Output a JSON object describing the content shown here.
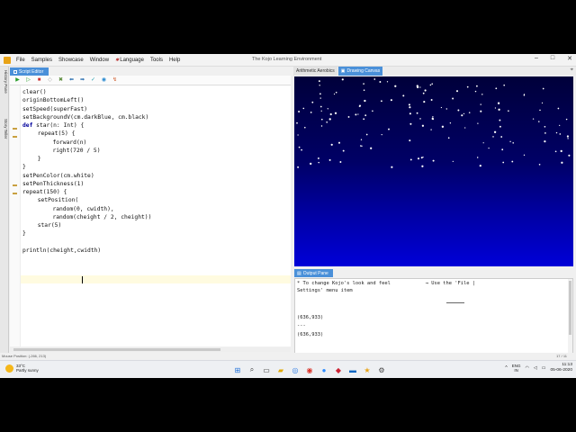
{
  "window": {
    "title": "The Kojo Learning Environment"
  },
  "menu": [
    "File",
    "Samples",
    "Showcase",
    "Window",
    "Language",
    "Tools",
    "Help"
  ],
  "side_tabs": [
    "History Pane",
    "Story Teller"
  ],
  "editor": {
    "tab_label": "Script Editor",
    "toolbar_icons": [
      "run-icon",
      "run-worksheet-icon",
      "stop-icon",
      "clear-icon",
      "tools-icon",
      "undo-icon",
      "redo-icon",
      "check-icon",
      "format-icon",
      "upload-icon"
    ],
    "lines": [
      {
        "text": "clear()",
        "indent": 0
      },
      {
        "text": "originBottomLeft()",
        "indent": 0
      },
      {
        "text": "setSpeed(superFast)",
        "indent": 0
      },
      {
        "text": "setBackgroundV(cm.darkBlue, cm.black)",
        "indent": 0
      },
      {
        "kw": "def",
        "text": " star(n: Int) {",
        "indent": 0
      },
      {
        "text": "repeat(5) {",
        "indent": 2
      },
      {
        "text": "forward(n)",
        "indent": 4
      },
      {
        "text": "right(720 / 5)",
        "indent": 4
      },
      {
        "text": "}",
        "indent": 2
      },
      {
        "text": "}",
        "indent": 0
      },
      {
        "text": "setPenColor(cm.white)",
        "indent": 0
      },
      {
        "text": "setPenThickness(1)",
        "indent": 0
      },
      {
        "text": "repeat(150) {",
        "indent": 0
      },
      {
        "text": "setPosition(",
        "indent": 2
      },
      {
        "text": "random(0, cwidth),",
        "indent": 4
      },
      {
        "text": "random(cheight / 2, cheight))",
        "indent": 4
      },
      {
        "text": "star(5)",
        "indent": 2
      },
      {
        "text": "}",
        "indent": 0
      },
      {
        "text": "",
        "indent": 0
      },
      {
        "text": "println(cheight,cwidth)",
        "indent": 0
      }
    ]
  },
  "right_tabs": [
    {
      "label": "Arithmetic Aerobics",
      "active": false
    },
    {
      "label": "Drawing Canvas",
      "active": true
    }
  ],
  "output": {
    "tab_label": "Output Pane",
    "lines": [
      "* To change Kojo's look and feel            → Use the 'File |",
      "Settings' menu item",
      "",
      "",
      "(636,933)",
      "---",
      "(636,933)"
    ]
  },
  "status": {
    "left": "Mouse Position: (-266, 213)",
    "right": "17 / 11"
  },
  "taskbar": {
    "weather_temp": "33°C",
    "weather_desc": "Partly sunny",
    "lang_line1": "ENG",
    "lang_line2": "IN",
    "time": "11:13",
    "date": "05-06-2020"
  },
  "colors": {
    "accent": "#4a90d9",
    "canvas_top": "#00003a",
    "canvas_bottom": "#0000d8"
  }
}
